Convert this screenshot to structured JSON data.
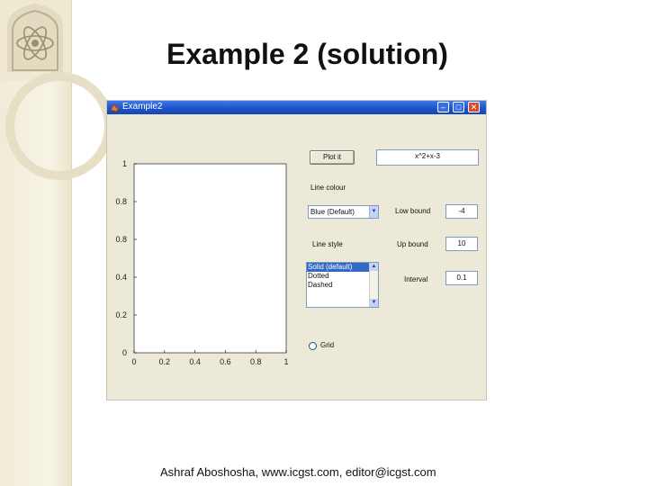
{
  "slide": {
    "title": "Example 2 (solution)",
    "footer": "Ashraf Aboshosha, www.icgst.com, editor@icgst.com"
  },
  "window": {
    "title": "Example2"
  },
  "plot": {
    "y_ticks": [
      "1",
      "0.8",
      "0.8",
      "0.4",
      "0.2",
      "0"
    ],
    "x_ticks": [
      "0",
      "0.2",
      "0.4",
      "0.6",
      "0.8",
      "1"
    ],
    "xlim": [
      0,
      1
    ],
    "ylim": [
      0,
      1
    ]
  },
  "controls": {
    "plot_button": "Plot it",
    "function_value": "x^2+x-3",
    "line_colour_label": "Line colour",
    "line_colour_selected": "Blue (Default)",
    "lower_bound_label": "Low bound",
    "lower_bound_value": "-4",
    "upper_bound_label": "Up bound",
    "upper_bound_value": "10",
    "line_style_label": "Line style",
    "line_styles": [
      "Solid (default)",
      "Dotted",
      "Dashed"
    ],
    "interval_label": "Interval",
    "interval_value": "0.1",
    "grid_label": "Grid"
  },
  "colors": {
    "titlebar": "#1d52c8",
    "window_bg": "#ece9d8",
    "selection": "#316ac5"
  }
}
